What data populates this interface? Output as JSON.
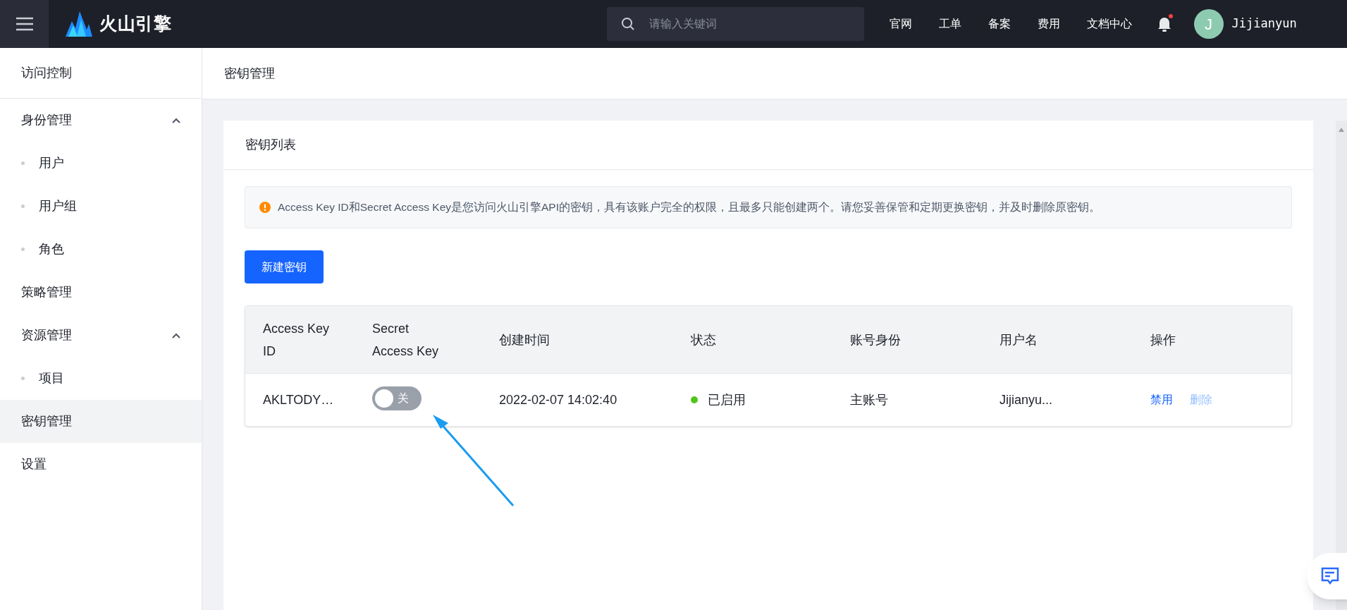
{
  "topbar": {
    "brand": "火山引擎",
    "search": {
      "placeholder": "请输入关键词"
    },
    "links": [
      "官网",
      "工单",
      "备案",
      "费用",
      "文档中心"
    ],
    "notifications": {
      "unread": true
    },
    "user": {
      "initial": "J",
      "name": "Jijianyun"
    }
  },
  "sidebar": {
    "title": "访问控制",
    "items": [
      {
        "label": "身份管理",
        "kind": "group",
        "expanded": true,
        "selected": false,
        "children": [
          {
            "label": "用户",
            "selected": false
          },
          {
            "label": "用户组",
            "selected": false
          },
          {
            "label": "角色",
            "selected": false
          }
        ]
      },
      {
        "label": "策略管理",
        "kind": "item",
        "selected": false
      },
      {
        "label": "资源管理",
        "kind": "group",
        "expanded": true,
        "selected": false,
        "children": [
          {
            "label": "项目",
            "selected": false
          }
        ]
      },
      {
        "label": "密钥管理",
        "kind": "item",
        "selected": true
      },
      {
        "label": "设置",
        "kind": "item",
        "selected": false
      }
    ]
  },
  "page_title": "密钥管理",
  "card": {
    "title": "密钥列表",
    "notice": "Access Key ID和Secret Access Key是您访问火山引擎API的密钥，具有该账户完全的权限，且最多只能创建两个。请您妥善保管和定期更换密钥，并及时删除原密钥。",
    "create_button": "新建密钥",
    "table": {
      "columns": [
        "Access Key ID",
        "Secret Access Key",
        "创建时间",
        "状态",
        "账号身份",
        "用户名",
        "操作"
      ],
      "rows": [
        {
          "access_key_id": "AKLTODY…",
          "secret": {
            "on": false,
            "label": "关"
          },
          "created": "2022-02-07 14:02:40",
          "status": {
            "label": "已启用",
            "color": "#52c41a"
          },
          "identity": "主账号",
          "username": "Jijianyu...",
          "actions": [
            {
              "label": "禁用",
              "disabled": false
            },
            {
              "label": "删除",
              "disabled": true
            }
          ]
        }
      ]
    }
  }
}
